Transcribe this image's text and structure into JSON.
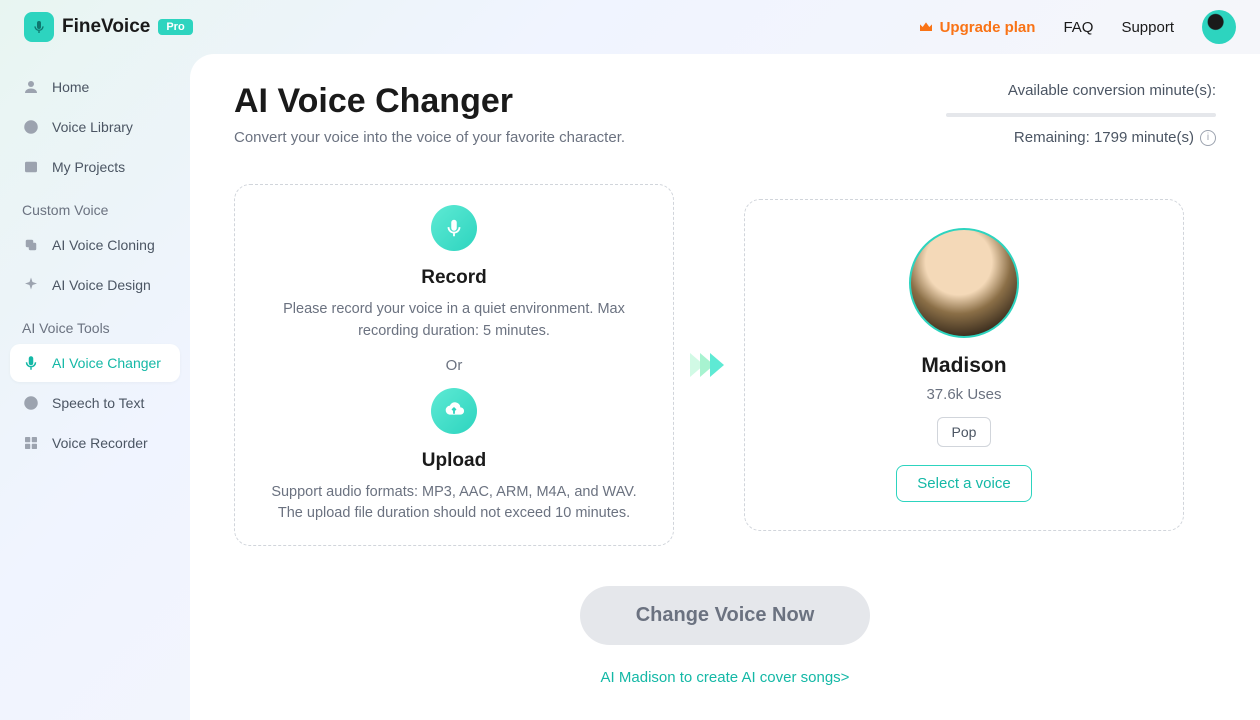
{
  "brand": {
    "name": "FineVoice",
    "badge": "Pro"
  },
  "header": {
    "upgrade": "Upgrade plan",
    "faq": "FAQ",
    "support": "Support"
  },
  "sidebar": {
    "items": [
      {
        "label": "Home"
      },
      {
        "label": "Voice Library"
      },
      {
        "label": "My Projects"
      }
    ],
    "section_custom": "Custom Voice",
    "custom": [
      {
        "label": "AI Voice Cloning"
      },
      {
        "label": "AI Voice Design"
      }
    ],
    "section_tools": "AI Voice Tools",
    "tools": [
      {
        "label": "AI Voice Changer"
      },
      {
        "label": "Speech to Text"
      },
      {
        "label": "Voice Recorder"
      }
    ]
  },
  "page": {
    "title": "AI Voice Changer",
    "subtitle": "Convert your voice into the voice of your favorite character.",
    "available_label": "Available conversion minute(s):",
    "remaining_label": "Remaining: 1799 minute(s)"
  },
  "input_card": {
    "record_title": "Record",
    "record_desc": "Please record your voice in a quiet environment. Max recording duration: 5 minutes.",
    "or": "Or",
    "upload_title": "Upload",
    "upload_desc": "Support audio formats: MP3, AAC, ARM, M4A, and WAV. The upload file duration should not exceed 10 minutes."
  },
  "voice": {
    "name": "Madison",
    "uses": "37.6k Uses",
    "tag": "Pop",
    "select_btn": "Select a voice"
  },
  "cta": {
    "button": "Change Voice Now",
    "cover_link": "AI Madison to create AI cover songs>"
  }
}
